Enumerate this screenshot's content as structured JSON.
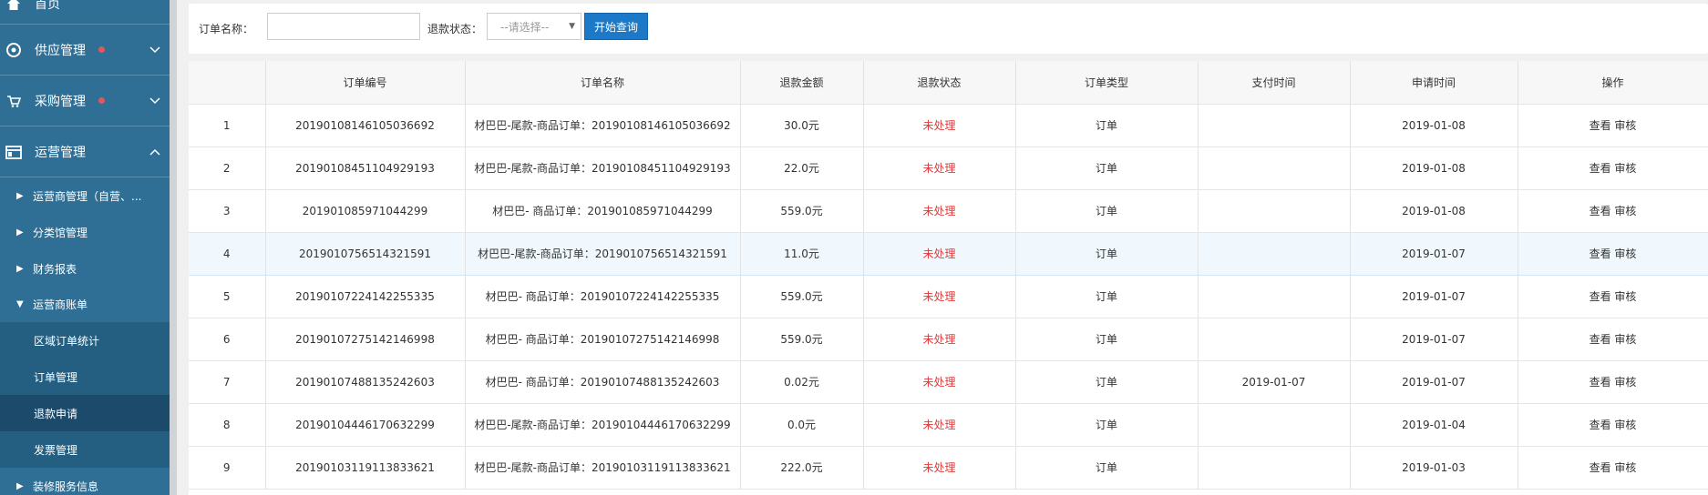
{
  "sidebar": {
    "home_label": "首页",
    "menus": [
      {
        "label": "供应管理"
      },
      {
        "label": "采购管理"
      },
      {
        "label": "运营管理"
      }
    ],
    "sub_items": [
      {
        "label": "运营商管理（自营、..."
      },
      {
        "label": "分类馆管理"
      },
      {
        "label": "财务报表"
      },
      {
        "label": "运营商账单"
      }
    ],
    "leaf_items": [
      {
        "label": "区域订单统计"
      },
      {
        "label": "订单管理"
      },
      {
        "label": "退款申请"
      },
      {
        "label": "发票管理"
      }
    ],
    "last_item": {
      "label": "装修服务信息"
    }
  },
  "search": {
    "order_name_label": "订单名称：",
    "order_name_value": "",
    "refund_status_label": "退款状态：",
    "refund_status_selected": "--请选择--",
    "submit_label": "开始查询"
  },
  "table": {
    "headers": [
      "",
      "订单编号",
      "订单名称",
      "退款金额",
      "退款状态",
      "订单类型",
      "支付时间",
      "申请时间",
      "操作"
    ],
    "view_label": "查看",
    "review_label": "审核",
    "rows": [
      {
        "idx": "1",
        "order_no": "20190108146105036692",
        "name": "材巴巴-尾款-商品订单：20190108146105036692",
        "amount": "30.0元",
        "status": "未处理",
        "type": "订单",
        "pay_time": "",
        "apply_time": "2019-01-08"
      },
      {
        "idx": "2",
        "order_no": "20190108451104929193",
        "name": "材巴巴-尾款-商品订单：20190108451104929193",
        "amount": "22.0元",
        "status": "未处理",
        "type": "订单",
        "pay_time": "",
        "apply_time": "2019-01-08"
      },
      {
        "idx": "3",
        "order_no": "201901085971044299",
        "name": "材巴巴- 商品订单：201901085971044299",
        "amount": "559.0元",
        "status": "未处理",
        "type": "订单",
        "pay_time": "",
        "apply_time": "2019-01-08"
      },
      {
        "idx": "4",
        "order_no": "2019010756514321591",
        "name": "材巴巴-尾款-商品订单：2019010756514321591",
        "amount": "11.0元",
        "status": "未处理",
        "type": "订单",
        "pay_time": "",
        "apply_time": "2019-01-07"
      },
      {
        "idx": "5",
        "order_no": "20190107224142255335",
        "name": "材巴巴- 商品订单：20190107224142255335",
        "amount": "559.0元",
        "status": "未处理",
        "type": "订单",
        "pay_time": "",
        "apply_time": "2019-01-07"
      },
      {
        "idx": "6",
        "order_no": "20190107275142146998",
        "name": "材巴巴- 商品订单：20190107275142146998",
        "amount": "559.0元",
        "status": "未处理",
        "type": "订单",
        "pay_time": "",
        "apply_time": "2019-01-07"
      },
      {
        "idx": "7",
        "order_no": "20190107488135242603",
        "name": "材巴巴- 商品订单：20190107488135242603",
        "amount": "0.02元",
        "status": "未处理",
        "type": "订单",
        "pay_time": "2019-01-07",
        "apply_time": "2019-01-07"
      },
      {
        "idx": "8",
        "order_no": "20190104446170632299",
        "name": "材巴巴-尾款-商品订单：20190104446170632299",
        "amount": "0.0元",
        "status": "未处理",
        "type": "订单",
        "pay_time": "",
        "apply_time": "2019-01-04"
      },
      {
        "idx": "9",
        "order_no": "20190103119113833621",
        "name": "材巴巴-尾款-商品订单：20190103119113833621",
        "amount": "222.0元",
        "status": "未处理",
        "type": "订单",
        "pay_time": "",
        "apply_time": "2019-01-03"
      }
    ]
  },
  "colors": {
    "sidebar_bg": "#2f6f95",
    "active_leaf": "#1b4a6b",
    "status_red": "#e03a3a",
    "button_blue": "#1b79c7"
  }
}
